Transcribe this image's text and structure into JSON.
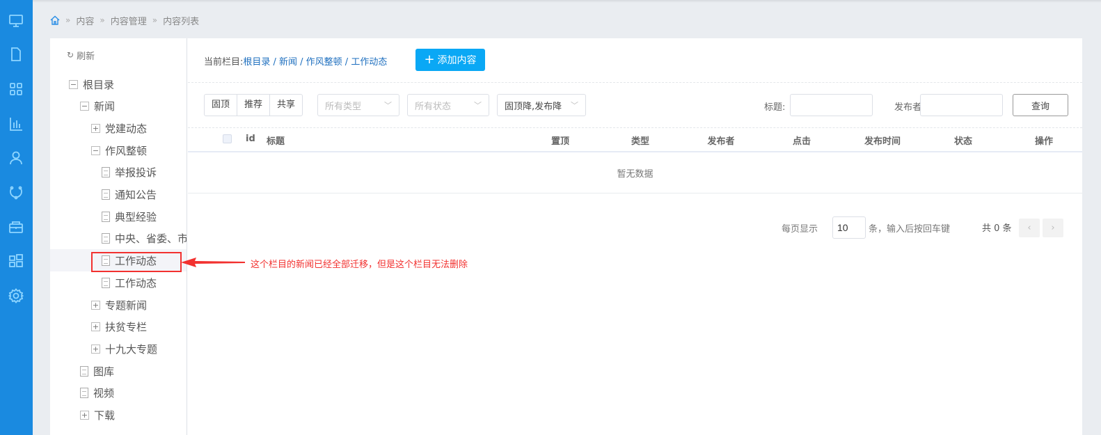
{
  "sidebar": {
    "icons": [
      "monitor-icon",
      "file-icon",
      "grid-icon",
      "chart-icon",
      "user-icon",
      "sync-icon",
      "box-icon",
      "apps-icon",
      "gear-icon"
    ]
  },
  "breadcrumb": [
    "内容",
    "内容管理",
    "内容列表"
  ],
  "tree": {
    "refresh": "刷新",
    "items": [
      {
        "label": "根目录",
        "type": "minus"
      },
      {
        "label": "新闻",
        "type": "minus"
      },
      {
        "label": "党建动态",
        "type": "plus"
      },
      {
        "label": "作风整顿",
        "type": "minus"
      },
      {
        "label": "举报投诉",
        "type": "doc"
      },
      {
        "label": "通知公告",
        "type": "doc"
      },
      {
        "label": "典型经验",
        "type": "doc"
      },
      {
        "label": "中央、省委、市委",
        "type": "doc"
      },
      {
        "label": "工作动态",
        "type": "doc",
        "selected": true
      },
      {
        "label": "工作动态",
        "type": "doc"
      },
      {
        "label": "专题新闻",
        "type": "plus"
      },
      {
        "label": "扶贫专栏",
        "type": "plus"
      },
      {
        "label": "十九大专题",
        "type": "plus"
      },
      {
        "label": "图库",
        "type": "doc"
      },
      {
        "label": "视频",
        "type": "doc"
      },
      {
        "label": "下载",
        "type": "plus"
      }
    ]
  },
  "header": {
    "current_label": "当前栏目:",
    "path": "根目录 / 新闻 / 作风整顿 / 工作动态",
    "add_button": "添加内容"
  },
  "filters": {
    "group": [
      "固顶",
      "推荐",
      "共享"
    ],
    "type_select": "所有类型",
    "status_select": "所有状态",
    "sort_select": "固顶降,发布降",
    "title_label": "标题:",
    "title_value": "",
    "publisher_label": "发布者:",
    "publisher_value": "",
    "query_button": "查询"
  },
  "table": {
    "columns": [
      "id",
      "标题",
      "置顶",
      "类型",
      "发布者",
      "点击",
      "发布时间",
      "状态",
      "操作"
    ],
    "empty": "暂无数据"
  },
  "pagination": {
    "per_page_label": "每页显示",
    "per_page": "10",
    "hint": "条，输入后按回车键",
    "total": "共 0 条"
  },
  "annotation": {
    "text": "这个栏目的新闻已经全部迁移，但是这个栏目无法删除",
    "color": "#f2312f"
  }
}
